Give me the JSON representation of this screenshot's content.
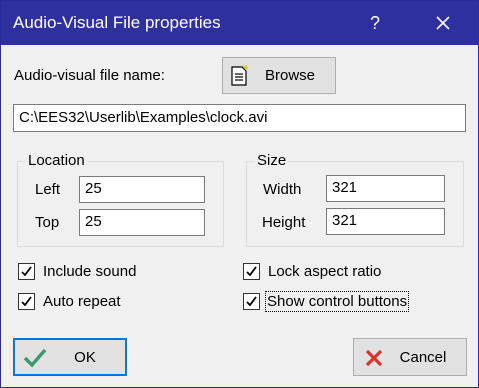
{
  "window": {
    "title": "Audio-Visual File properties",
    "help_glyph": "?"
  },
  "file": {
    "label": "Audio-visual file name:",
    "browse_label": "Browse",
    "path": "C:\\EES32\\Userlib\\Examples\\clock.avi"
  },
  "location": {
    "title": "Location",
    "left_label": "Left",
    "left_value": "25",
    "top_label": "Top",
    "top_value": "25"
  },
  "size": {
    "title": "Size",
    "width_label": "Width",
    "width_value": "321",
    "height_label": "Height",
    "height_value": "321"
  },
  "options": {
    "include_sound": {
      "label": "Include sound",
      "checked": true
    },
    "auto_repeat": {
      "label": "Auto repeat",
      "checked": true
    },
    "lock_aspect_ratio": {
      "label": "Lock aspect ratio",
      "checked": true
    },
    "show_control_buttons": {
      "label": "Show control buttons",
      "checked": true
    }
  },
  "buttons": {
    "ok_label": "OK",
    "cancel_label": "Cancel"
  },
  "colors": {
    "title_bar": "#2f2fa0",
    "ok_check": "#3a9a6a",
    "cancel_x": "#d9362a",
    "ok_border": "#0078d7"
  }
}
